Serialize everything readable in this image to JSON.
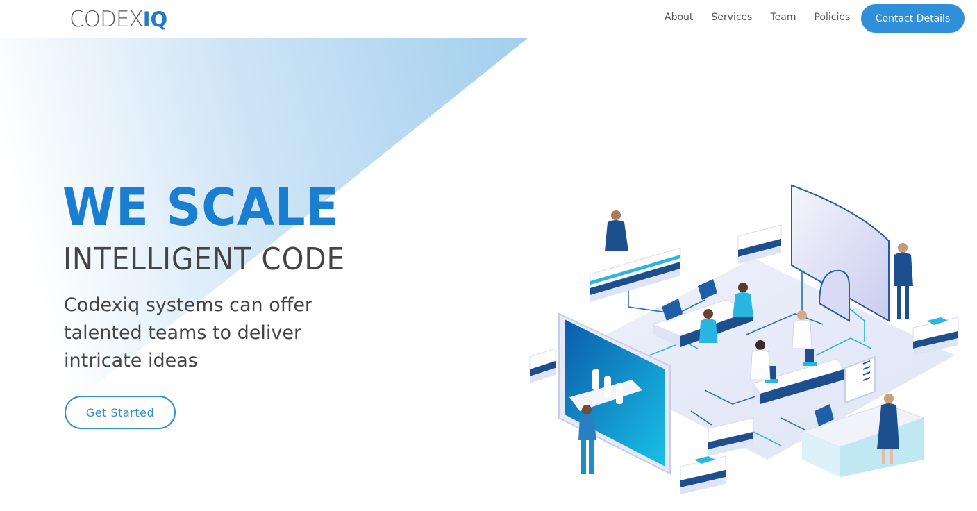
{
  "header": {
    "logo_light": "CODEX",
    "logo_bold": "IQ",
    "nav": [
      "About",
      "Services",
      "Team",
      "Policies"
    ],
    "contact_label": "Contact Details"
  },
  "hero": {
    "headline_1": "WE SCALE",
    "headline_2": "INTELLIGENT CODE",
    "subtext": "Codexiq systems can offer talented teams to deliver intricate ideas",
    "cta_label": "Get Started"
  },
  "colors": {
    "accent": "#2f8fd9",
    "headline_blue": "#1a7fd1",
    "text_dark": "#444444",
    "hero_gradient_start": "#ffffff",
    "hero_gradient_end": "#a8d2ef"
  },
  "icons": {
    "illustration": "isometric-lab-illustration-icon"
  }
}
